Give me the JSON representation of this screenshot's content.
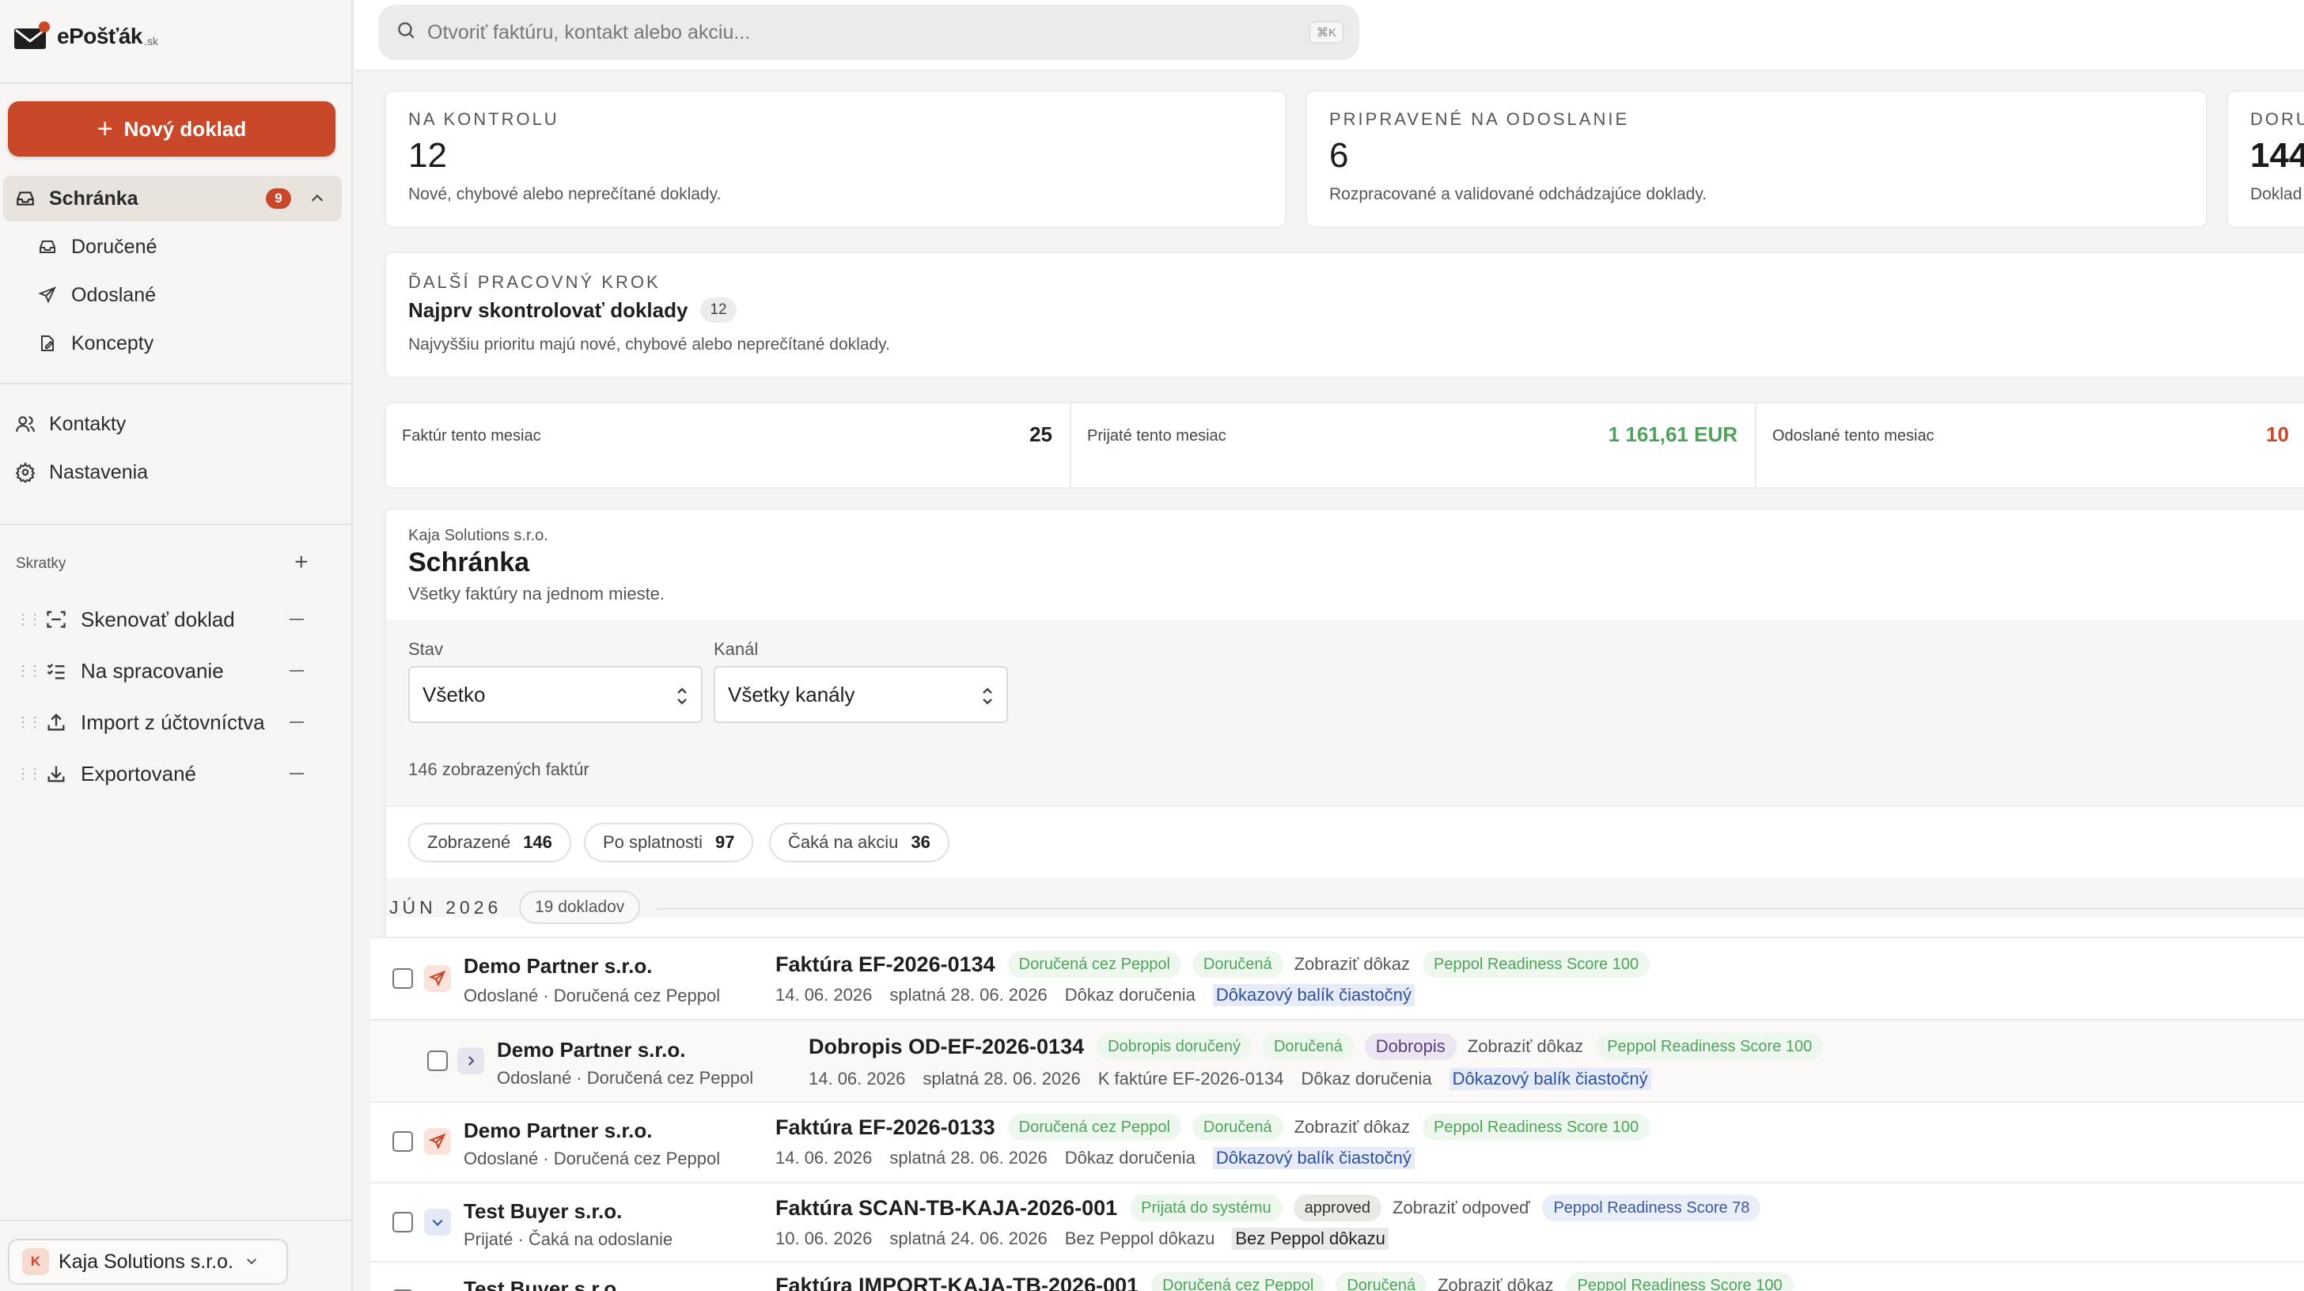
{
  "app": {
    "logo_text": "ePošťák",
    "logo_suffix": ".sk"
  },
  "sidebar": {
    "new_button": "Nový doklad",
    "inbox": {
      "label": "Schránka",
      "badge": "9"
    },
    "inbox_sub": [
      {
        "label": "Doručené",
        "icon": "inbox-icon"
      },
      {
        "label": "Odoslané",
        "icon": "send-icon"
      },
      {
        "label": "Koncepty",
        "icon": "draft-icon"
      }
    ],
    "main_items": [
      {
        "label": "Kontakty",
        "icon": "users-icon"
      },
      {
        "label": "Nastavenia",
        "icon": "gear-icon"
      }
    ],
    "shortcuts_title": "Skratky",
    "shortcuts": [
      {
        "label": "Skenovať doklad",
        "icon": "scan-icon"
      },
      {
        "label": "Na spracovanie",
        "icon": "checklist-icon"
      },
      {
        "label": "Import z účtovníctva",
        "icon": "upload-icon"
      },
      {
        "label": "Exportované",
        "icon": "download-icon"
      }
    ],
    "company": {
      "initial": "K",
      "name": "Kaja Solutions s.r.o."
    }
  },
  "search": {
    "placeholder": "Otvoriť faktúru, kontakt alebo akciu...",
    "shortcut": "⌘K"
  },
  "summary_cards": [
    {
      "kicker": "NA KONTROLU",
      "value": "12",
      "desc": "Nové, chybové alebo neprečítané doklady."
    },
    {
      "kicker": "PRIPRAVENÉ NA ODOSLANIE",
      "value": "6",
      "desc": "Rozpracované a validované odchádzajúce doklady."
    },
    {
      "kicker": "DORU",
      "value": "144",
      "desc": "Doklad"
    }
  ],
  "next_step": {
    "kicker": "ĎALŠÍ PRACOVNÝ KROK",
    "title": "Najprv skontrolovať doklady",
    "count": "12",
    "desc": "Najvyššiu prioritu majú nové, chybové alebo neprečítané doklady."
  },
  "stats": [
    {
      "label": "Faktúr tento mesiac",
      "value": "25",
      "color": "#1e1e1e"
    },
    {
      "label": "Prijaté tento mesiac",
      "value": "1 161,61 EUR",
      "color": "#4ea25b"
    },
    {
      "label": "Odoslané tento mesiac",
      "value": "10",
      "color": "#c9482a"
    }
  ],
  "inbox_panel": {
    "company": "Kaja Solutions s.r.o.",
    "title": "Schránka",
    "subtitle": "Všetky faktúry na jednom mieste.",
    "filter_state_label": "Stav",
    "filter_state_value": "Všetko",
    "filter_channel_label": "Kanál",
    "filter_channel_value": "Všetky kanály",
    "count_text": "146 zobrazených faktúr"
  },
  "pills": [
    {
      "label": "Zobrazené",
      "value": "146"
    },
    {
      "label": "Po splatnosti",
      "value": "97"
    },
    {
      "label": "Čaká na akciu",
      "value": "36"
    }
  ],
  "group": {
    "month": "JÚN 2026",
    "count": "19 dokladov"
  },
  "rows": [
    {
      "partner": "Demo Partner s.r.o.",
      "sub": "Odoslané · Doručená cez Peppol",
      "doc": "Faktúra EF-2026-0134",
      "tags": [
        "Doručená cez Peppol",
        "Doručená"
      ],
      "link": "Zobraziť dôkaz",
      "score": "Peppol Readiness Score 100",
      "date": "14. 06. 2026",
      "due": "splatná 28. 06. 2026",
      "proof_label": "Dôkaz doručenia",
      "proof_value": "Dôkazový balík čiastočný"
    },
    {
      "partner": "Demo Partner s.r.o.",
      "sub": "Odoslané · Doručená cez Peppol",
      "doc": "Dobropis OD-EF-2026-0134",
      "tags": [
        "Dobropis doručený",
        "Doručená"
      ],
      "type_tag": "Dobropis",
      "link": "Zobraziť dôkaz",
      "score": "Peppol Readiness Score 100",
      "date": "14. 06. 2026",
      "due": "splatná 28. 06. 2026",
      "ref": "K faktúre EF-2026-0134",
      "proof_label": "Dôkaz doručenia",
      "proof_value": "Dôkazový balík čiastočný"
    },
    {
      "partner": "Demo Partner s.r.o.",
      "sub": "Odoslané · Doručená cez Peppol",
      "doc": "Faktúra EF-2026-0133",
      "tags": [
        "Doručená cez Peppol",
        "Doručená"
      ],
      "link": "Zobraziť dôkaz",
      "score": "Peppol Readiness Score 100",
      "date": "14. 06. 2026",
      "due": "splatná 28. 06. 2026",
      "proof_label": "Dôkaz doručenia",
      "proof_value": "Dôkazový balík čiastočný"
    },
    {
      "partner": "Test Buyer s.r.o.",
      "sub": "Prijaté · Čaká na odoslanie",
      "doc": "Faktúra SCAN-TB-KAJA-2026-001",
      "tags": [
        "Prijatá do systému"
      ],
      "state_tag": "approved",
      "link": "Zobraziť odpoveď",
      "score": "Peppol Readiness Score 78",
      "date": "10. 06. 2026",
      "due": "splatná 24. 06. 2026",
      "proof_label": "Bez Peppol dôkazu",
      "proof_value": "Bez Peppol dôkazu"
    },
    {
      "partner": "Test Buyer s.r.o.",
      "doc": "Faktúra IMPORT-KAJA-TB-2026-001",
      "tags": [
        "Doručená cez Peppol",
        "Doručená"
      ],
      "link": "Zobraziť dôkaz",
      "score": "Peppol Readiness Score 100"
    }
  ]
}
